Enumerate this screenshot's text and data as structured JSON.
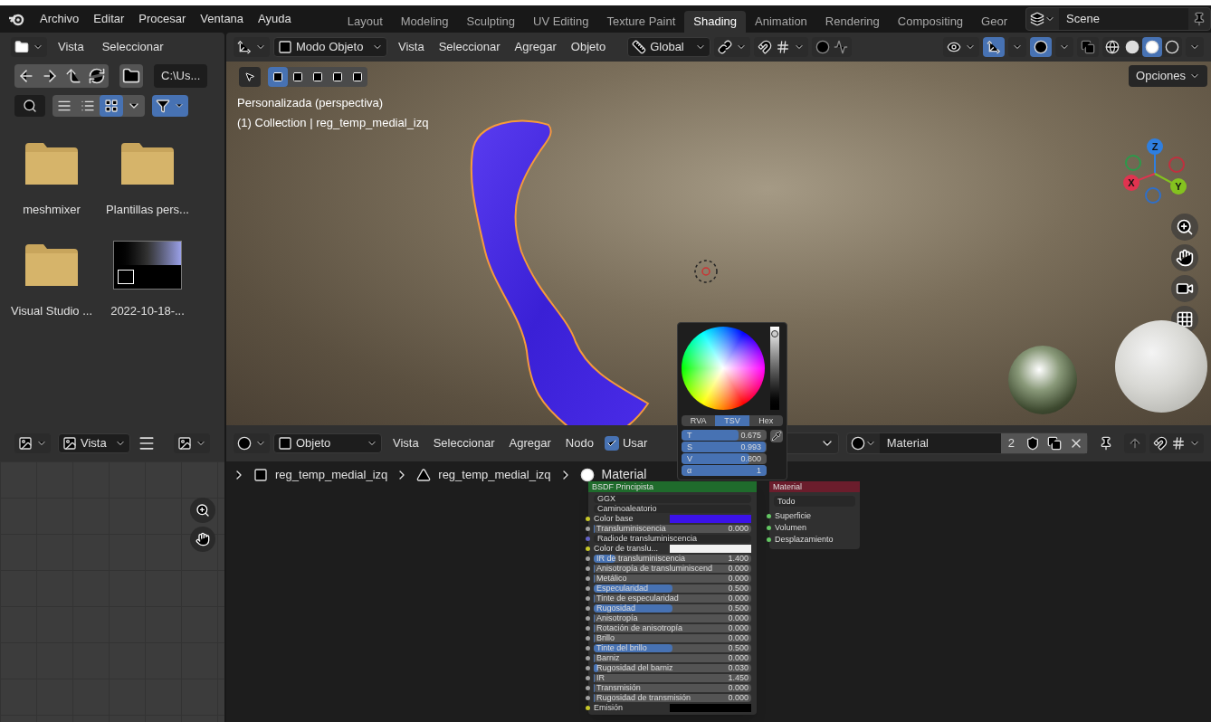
{
  "top_menu": [
    "Archivo",
    "Editar",
    "Procesar",
    "Ventana",
    "Ayuda"
  ],
  "workspace_tabs": [
    {
      "label": "Layout",
      "selected": false
    },
    {
      "label": "Modeling",
      "selected": false
    },
    {
      "label": "Sculpting",
      "selected": false
    },
    {
      "label": "UV Editing",
      "selected": false
    },
    {
      "label": "Texture Paint",
      "selected": false
    },
    {
      "label": "Shading",
      "selected": true
    },
    {
      "label": "Animation",
      "selected": false
    },
    {
      "label": "Rendering",
      "selected": false
    },
    {
      "label": "Compositing",
      "selected": false
    },
    {
      "label": "Geor",
      "selected": false
    }
  ],
  "scene": "Scene",
  "file_browser": {
    "menus": [
      "Vista",
      "Seleccionar"
    ],
    "path": "C:\\Us...",
    "view_modes": [
      {
        "selected": false
      },
      {
        "selected": false
      },
      {
        "selected": true
      }
    ],
    "filter_on": true,
    "files": [
      {
        "name": "meshmixer",
        "kind": "folder"
      },
      {
        "name": "Plantillas pers...",
        "kind": "folder"
      },
      {
        "name": "Visual Studio ...",
        "kind": "folder"
      },
      {
        "name": "2022-10-18-...",
        "kind": "image"
      }
    ]
  },
  "viewport": {
    "mode": "Modo Objeto",
    "menus": [
      "Vista",
      "Seleccionar",
      "Agregar",
      "Objeto"
    ],
    "orientation": "Global",
    "options": "Opciones",
    "select_modes": [
      {
        "selected": true
      },
      {
        "selected": false
      },
      {
        "selected": false
      },
      {
        "selected": false
      },
      {
        "selected": false
      }
    ],
    "gizmos_on": true,
    "overlays_on": true,
    "shading_modes": [
      {
        "selected": false
      },
      {
        "selected": false
      },
      {
        "selected": true
      },
      {
        "selected": false
      }
    ],
    "info": [
      "Personalizada (perspectiva)",
      "(1) Collection | reg_temp_medial_izq"
    ],
    "axes": [
      {
        "label": "Z",
        "color": "#2f7fe0"
      },
      {
        "label": "X",
        "color": "#e0334f"
      },
      {
        "label": "Y",
        "color": "#84c21f"
      }
    ]
  },
  "image_editor": {
    "view": "Vista"
  },
  "node_editor": {
    "editor": "Objeto",
    "menus": [
      "Vista",
      "Seleccionar",
      "Agregar",
      "Nodo"
    ],
    "use_nodes": {
      "label": "Usar",
      "checked": true
    },
    "material": "Material",
    "users": "2",
    "breadcrumbs": [
      {
        "label": "reg_temp_medial_izq",
        "kind": "object"
      },
      {
        "label": "reg_temp_medial_izq",
        "kind": "mesh"
      },
      {
        "label": "Material",
        "kind": "material"
      }
    ],
    "bsdf_node": {
      "title": "BSDF Principista",
      "rows": [
        {
          "kind": "enum",
          "label": "GGX"
        },
        {
          "kind": "enum",
          "label": "Caminoaleatorio"
        },
        {
          "kind": "color",
          "label": "Color base",
          "color": "#3b12e8"
        },
        {
          "kind": "value",
          "label": "Transluminiscencia",
          "value": "0.000",
          "level": 0
        },
        {
          "kind": "vector",
          "label": "Radiode transluminiscencia"
        },
        {
          "kind": "color",
          "label": "Color de translu...",
          "color": "#f2f2f2"
        },
        {
          "kind": "value",
          "label": "IR de transluminiscencia",
          "value": "1.400",
          "level": 0.14
        },
        {
          "kind": "value",
          "label": "Anisotropía de transluminiscend",
          "value": "0.000",
          "level": 0
        },
        {
          "kind": "value",
          "label": "Metálico",
          "value": "0.000",
          "level": 0
        },
        {
          "kind": "value",
          "label": "Especularidad",
          "value": "0.500",
          "level": 0.5
        },
        {
          "kind": "value",
          "label": "Tinte de especularidad",
          "value": "0.000",
          "level": 0
        },
        {
          "kind": "value",
          "label": "Rugosidad",
          "value": "0.500",
          "level": 0.5
        },
        {
          "kind": "value",
          "label": "Anisotropía",
          "value": "0.000",
          "level": 0
        },
        {
          "kind": "value",
          "label": "Rotación de anisotropía",
          "value": "0.000",
          "level": 0
        },
        {
          "kind": "value",
          "label": "Brillo",
          "value": "0.000",
          "level": 0
        },
        {
          "kind": "value",
          "label": "Tinte del brillo",
          "value": "0.500",
          "level": 0.5
        },
        {
          "kind": "value",
          "label": "Barniz",
          "value": "0.000",
          "level": 0
        },
        {
          "kind": "value",
          "label": "Rugosidad del barniz",
          "value": "0.030",
          "level": 0.03
        },
        {
          "kind": "value",
          "label": "IR",
          "value": "1.450",
          "level": 0
        },
        {
          "kind": "value",
          "label": "Transmisión",
          "value": "0.000",
          "level": 0
        },
        {
          "kind": "value",
          "label": "Rugosidad de transmisión",
          "value": "0.000",
          "level": 0
        },
        {
          "kind": "color",
          "label": "Emisión",
          "color": "#000000"
        }
      ]
    },
    "output_node": {
      "title": "Material",
      "target": "Todo",
      "inputs": [
        "Superficie",
        "Volumen",
        "Desplazamiento"
      ]
    }
  },
  "color_picker": {
    "value_bar": {
      "level": 0.95
    },
    "modes": [
      {
        "label": "RVA",
        "selected": false
      },
      {
        "label": "TSV",
        "selected": true
      },
      {
        "label": "Hex",
        "selected": false
      }
    ],
    "sliders": [
      {
        "label": "T",
        "value": "0.675",
        "level": 0.675
      },
      {
        "label": "S",
        "value": "0.993",
        "level": 0.993
      },
      {
        "label": "V",
        "value": "0.800",
        "level": 0.8
      },
      {
        "label": "α",
        "value": "1",
        "level": 1
      }
    ]
  }
}
